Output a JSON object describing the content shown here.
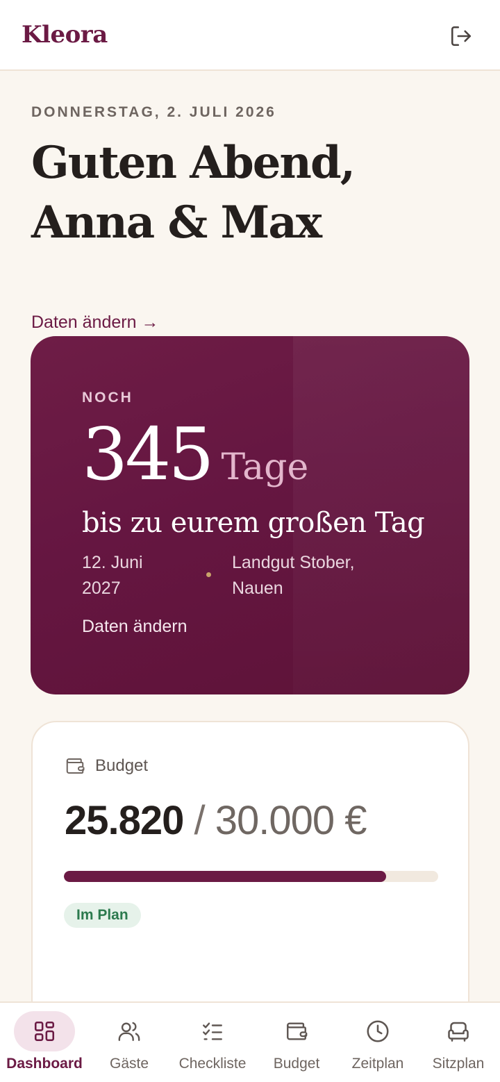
{
  "header": {
    "brand": "Kleora",
    "logout_icon": "logout-icon"
  },
  "greeting": {
    "dateline": "DONNERSTAG, 2. JULI 2026",
    "title": "Guten Abend, Anna & Max",
    "edit_link": "Daten ändern →"
  },
  "countdown": {
    "label": "NOCH",
    "days": "345",
    "unit": "Tage",
    "subtitle": "bis zu eurem großen Tag",
    "date": "12. Juni 2027",
    "location": "Landgut Stober, Nauen",
    "edit": "Daten ändern"
  },
  "budget": {
    "icon": "wallet-icon",
    "title": "Budget",
    "spent": "25.820",
    "separator": " / ",
    "total": "30.000 €",
    "progress_fraction": 0.8607,
    "status": "Im Plan"
  },
  "nav": {
    "items": [
      {
        "label": "Dashboard",
        "icon": "dashboard-icon",
        "active": true
      },
      {
        "label": "Gäste",
        "icon": "guests-icon",
        "active": false
      },
      {
        "label": "Checkliste",
        "icon": "checklist-icon",
        "active": false
      },
      {
        "label": "Budget",
        "icon": "wallet-icon",
        "active": false
      },
      {
        "label": "Zeitplan",
        "icon": "clock-icon",
        "active": false
      },
      {
        "label": "Sitzplan",
        "icon": "seat-icon",
        "active": false
      }
    ]
  },
  "colors": {
    "accent": "#6b1a44",
    "background": "#faf6f0",
    "status_green": "#2c7a4e"
  }
}
